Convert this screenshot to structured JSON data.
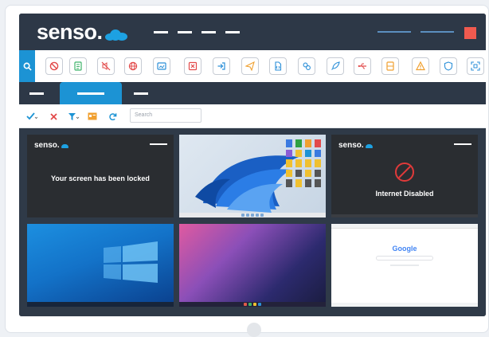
{
  "app": {
    "logo_text": "senso."
  },
  "search": {
    "placeholder": "Search"
  },
  "tiles": [
    {
      "kind": "lock",
      "logo_text": "senso.",
      "message": "Your screen has been locked"
    },
    {
      "kind": "win11-bloom"
    },
    {
      "kind": "internet-disabled",
      "logo_text": "senso.",
      "message": "Internet Disabled"
    },
    {
      "kind": "win10-desktop"
    },
    {
      "kind": "gradient-desktop"
    },
    {
      "kind": "browser",
      "search_logo": "Google"
    }
  ],
  "colors": {
    "accent": "#1c93d4",
    "topbar": "#2d3847",
    "danger": "#f05a4f",
    "icon_orange": "#f0a030",
    "icon_green": "#3fb36b",
    "icon_red": "#e24a4a",
    "icon_blue": "#2b8fd8"
  },
  "icons": [
    "block-icon",
    "checklist-icon",
    "mute-icon",
    "globe-icon",
    "screenshot-icon",
    "close-window-icon",
    "login-icon",
    "send-icon",
    "file-icon",
    "settings-icon",
    "rocket-icon",
    "usb-icon",
    "storage-icon",
    "warning-icon",
    "shield-icon",
    "scan-icon"
  ]
}
